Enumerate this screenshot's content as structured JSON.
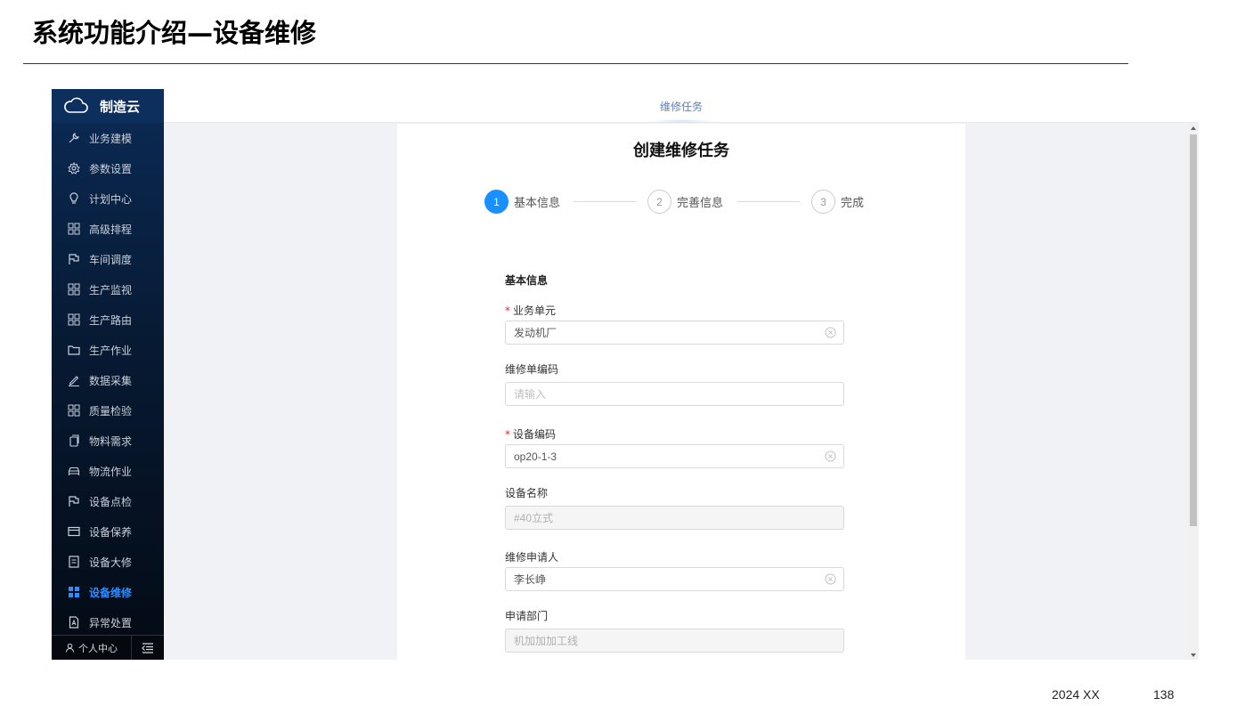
{
  "slide": {
    "title": "系统功能介绍—设备维修",
    "footer_date": "2024 XX",
    "page_number": "138"
  },
  "sidebar": {
    "brand": "制造云",
    "items": [
      {
        "label": "业务建模",
        "icon": "wrench-icon"
      },
      {
        "label": "参数设置",
        "icon": "gear-icon"
      },
      {
        "label": "计划中心",
        "icon": "lightbulb-icon"
      },
      {
        "label": "高级排程",
        "icon": "grid-icon"
      },
      {
        "label": "车间调度",
        "icon": "flag-icon"
      },
      {
        "label": "生产监视",
        "icon": "grid-icon"
      },
      {
        "label": "生产路由",
        "icon": "grid-icon"
      },
      {
        "label": "生产作业",
        "icon": "folder-icon"
      },
      {
        "label": "数据采集",
        "icon": "pen-icon"
      },
      {
        "label": "质量检验",
        "icon": "grid-icon"
      },
      {
        "label": "物料需求",
        "icon": "copy-icon"
      },
      {
        "label": "物流作业",
        "icon": "car-icon"
      },
      {
        "label": "设备点检",
        "icon": "flag-icon"
      },
      {
        "label": "设备保养",
        "icon": "card-icon"
      },
      {
        "label": "设备大修",
        "icon": "notebook-icon"
      },
      {
        "label": "设备维修",
        "icon": "grid-filled-icon",
        "active": true
      },
      {
        "label": "异常处置",
        "icon": "document-icon"
      }
    ],
    "footer": {
      "personal": "个人中心"
    }
  },
  "topbar": {
    "tab": "维修任务"
  },
  "form": {
    "title": "创建维修任务",
    "steps": [
      {
        "num": "1",
        "label": "基本信息"
      },
      {
        "num": "2",
        "label": "完善信息"
      },
      {
        "num": "3",
        "label": "完成"
      }
    ],
    "section": "基本信息",
    "fields": {
      "business_unit": {
        "label": "业务单元",
        "value": "发动机厂"
      },
      "repair_code": {
        "label": "维修单编码",
        "placeholder": "请输入"
      },
      "device_code": {
        "label": "设备编码",
        "value": "op20-1-3"
      },
      "device_name": {
        "label": "设备名称",
        "value": "#40立式"
      },
      "applicant": {
        "label": "维修申请人",
        "value": "李长峥"
      },
      "department": {
        "label": "申请部门",
        "value": "机加加加工线"
      }
    }
  },
  "colors": {
    "accent": "#1890ff",
    "required": "#f5222d",
    "sidebar_top": "#0b2a55"
  }
}
